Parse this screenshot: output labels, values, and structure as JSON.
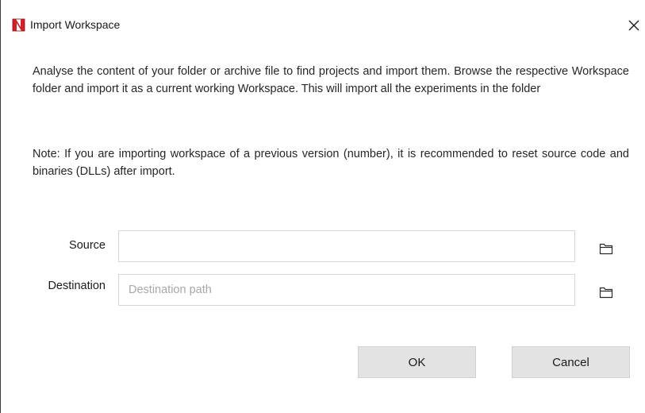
{
  "window": {
    "title": "Import Workspace",
    "logo_icon": "app-logo-icon",
    "close_icon": "close-icon"
  },
  "content": {
    "description": "Analyse the content of your folder or archive file to find projects and import them. Browse the respective Workspace folder and import it as a current working Workspace. This will import all the experiments in the folder",
    "note": "Note: If you are importing workspace of a previous version (number), it is recommended to reset source code and binaries (DLLs) after import."
  },
  "form": {
    "source": {
      "label": "Source",
      "value": "",
      "placeholder": "",
      "browse_icon": "folder-icon"
    },
    "destination": {
      "label": "Destination",
      "value": "",
      "placeholder": "Destination path",
      "browse_icon": "folder-icon"
    }
  },
  "actions": {
    "ok_label": "OK",
    "cancel_label": "Cancel"
  },
  "colors": {
    "logo_red": "#d0202a",
    "button_bg": "#e3e3e3",
    "input_border": "#d6d6d6",
    "placeholder": "#a8a8a8"
  }
}
